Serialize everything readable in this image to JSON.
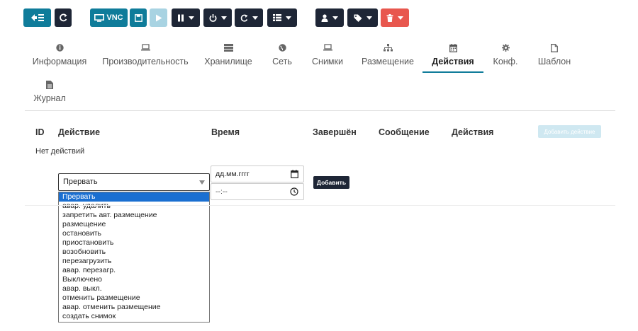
{
  "toolbar": {
    "vnc_label": "VNC"
  },
  "tabs": [
    {
      "label": "Информация",
      "icon": "info-icon"
    },
    {
      "label": "Производительность",
      "icon": "laptop-icon"
    },
    {
      "label": "Хранилище",
      "icon": "storage-icon"
    },
    {
      "label": "Сеть",
      "icon": "globe-icon"
    },
    {
      "label": "Снимки",
      "icon": "laptop-icon"
    },
    {
      "label": "Размещение",
      "icon": "sitemap-icon"
    },
    {
      "label": "Действия",
      "icon": "calendar-icon",
      "active": true
    },
    {
      "label": "Конф.",
      "icon": "gear-icon"
    },
    {
      "label": "Шаблон",
      "icon": "file-icon"
    },
    {
      "label": "Журнал",
      "icon": "file-text-icon"
    }
  ],
  "table": {
    "headers": [
      "ID",
      "Действие",
      "Время",
      "Завершён",
      "Сообщение",
      "Действия"
    ],
    "add_action_label": "Добавить действие",
    "empty_text": "Нет действий"
  },
  "form": {
    "selected_action": "Прервать",
    "date_placeholder": "дд.мм.гггг",
    "time_placeholder": "--:--",
    "add_label": "Добавить",
    "options": [
      "Прервать",
      "авар. удалить",
      "запретить авт. размещение",
      "размещение",
      "остановить",
      "приостановить",
      "возобновить",
      "перезагрузить",
      "авар. перезагр.",
      "Выключено",
      "авар. выкл.",
      "отменить размещение",
      "авар. отменить размещение",
      "создать снимок"
    ]
  },
  "colors": {
    "teal": "#0f7c9a",
    "dark": "#1e2636",
    "danger": "#e8574e",
    "selection": "#1a6fd1"
  }
}
